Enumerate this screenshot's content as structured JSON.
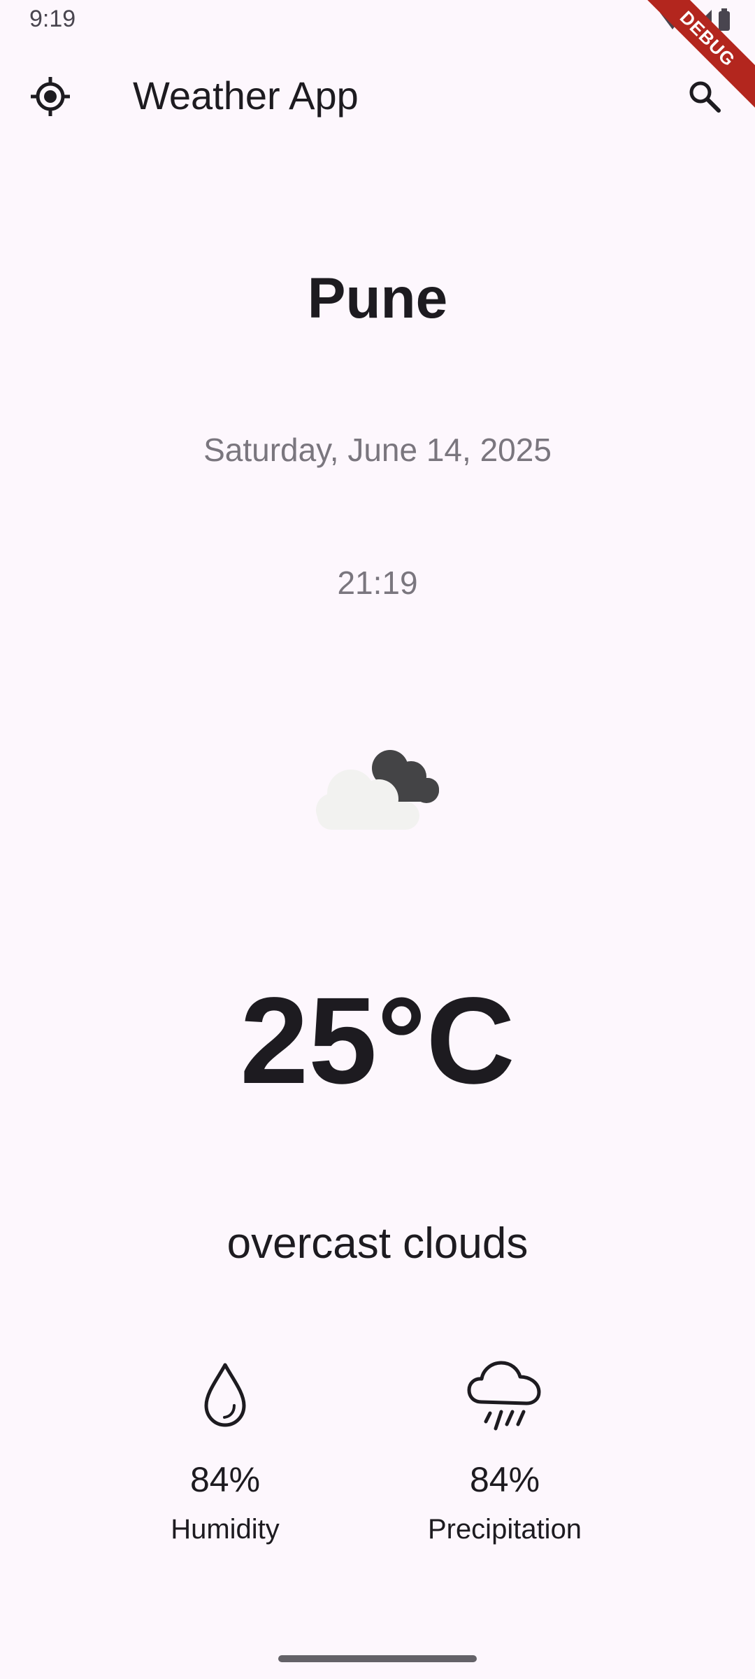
{
  "status_bar": {
    "time": "9:19",
    "icons": [
      "wifi-icon",
      "signal-icon",
      "battery-icon"
    ]
  },
  "debug_banner": "DEBUG",
  "app_bar": {
    "title": "Weather App",
    "leading_icon": "my-location-icon",
    "trailing_icon": "search-icon"
  },
  "weather": {
    "city": "Pune",
    "date": "Saturday, June 14, 2025",
    "time": "21:19",
    "icon": "overcast-clouds-icon",
    "temperature": "25°C",
    "condition": "overcast clouds"
  },
  "stats": {
    "humidity": {
      "icon": "water-drop-icon",
      "value": "84%",
      "label": "Humidity"
    },
    "precipitation": {
      "icon": "rain-cloud-icon",
      "value": "84%",
      "label": "Precipitation"
    }
  },
  "colors": {
    "background": "#FDF7FD",
    "text_primary": "#1D1B20",
    "text_secondary": "#7A767E",
    "debug_ribbon": "#B3261E"
  }
}
